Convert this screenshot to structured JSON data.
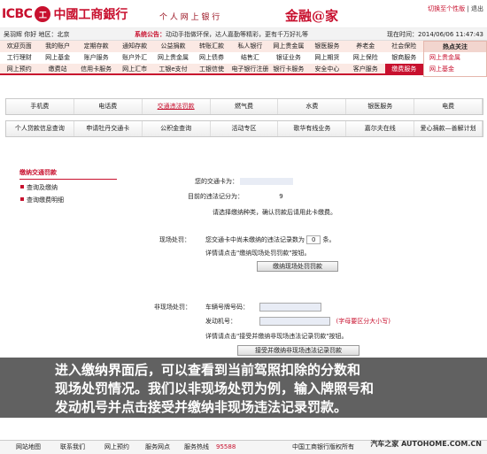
{
  "header": {
    "logo_icbc": "ICBC",
    "logo_seal": "工",
    "logo_cn": "中國工商銀行",
    "slogan": "个 人 网 上 银 行",
    "brand": "金融@家",
    "switch": "切换至个性版",
    "hint": "| 退出",
    "date": "现在时间：2014/06/06 11:47:43"
  },
  "userbar": {
    "user": "吴羽辉 你好 地区：北京",
    "notice_label": "系统公告：",
    "notice_text": "动动手指做环保，达人嘉勤等精彩，更有千万好礼等",
    "time": "2014/06/06 11:47:43"
  },
  "nav": {
    "row1": [
      "欢迎页面",
      "我的账户",
      "定期存款",
      "通知存款",
      "公益捐款",
      "转账汇款",
      "私人银行",
      "网上贵金属",
      "银医服务",
      "养老金",
      "社会保险"
    ],
    "row2": [
      "工行理财",
      "网上基金",
      "账户服务",
      "账户外汇",
      "网上贵金属",
      "网上债券",
      "结售汇",
      "银证业务",
      "网上期货",
      "网上保险",
      "银商服务"
    ],
    "row3": [
      "网上预约",
      "缴费站",
      "信用卡服务",
      "网上汇市",
      "工银e支付",
      "工银信使",
      "电子银行注册",
      "银行卡服务",
      "安全中心",
      "客户服务",
      "缴费服务"
    ],
    "active": "缴费服务"
  },
  "hot": {
    "title": "热点关注",
    "items": [
      "网上贵金属",
      "网上基金"
    ]
  },
  "tabs1": [
    "手机费",
    "电话费",
    "交通违法罚款",
    "燃气费",
    "水费",
    "银医服务",
    "电费"
  ],
  "tabs1_selected": "交通违法罚款",
  "tabs2": [
    "个人贷款信息查询",
    "申请牡丹交通卡",
    "公积金查询",
    "活动专区",
    "歌华有线业务",
    "嘉尔夫在线",
    "爱心捐款—善解计划"
  ],
  "left": {
    "title": "缴纳交通罚款",
    "items": [
      "查询及缴纳",
      "查询缴费明细"
    ]
  },
  "main": {
    "card_label": "您的交通卡为：",
    "points_label": "目前的违法记分为：",
    "points_value": "9",
    "choose": "请选择缴纳种类，确认罚款后请用此卡缴费。",
    "onsite_label": "现场处罚：",
    "onsite_text": "您交通卡中尚未缴纳的违法记录数为",
    "onsite_count": "0",
    "onsite_unit": "条。",
    "onsite_detail": "详情请点击\"缴纳现场处罚罚款\"按钮。",
    "onsite_btn": "缴纳现场处罚罚款",
    "offsite_label": "非现场处罚：",
    "plate_label": "车辆号牌号码：",
    "engine_label": "发动机号：",
    "case_hint": "(字母要区分大小写)",
    "offsite_detail": "详情请点击\"接受并缴纳非现场违法记录罚款\"按钮。",
    "offsite_btn": "接受并缴纳非现场违法记录罚款"
  },
  "subtitle": [
    "进入缴纳界面后，可以查看到当前驾照扣除的分数和",
    "现场处罚情况。我们以非现场处罚为例，输入牌照号和",
    "发动机号并点击接受并缴纳非现场违法记录罚款。"
  ],
  "footer": {
    "items": [
      "网站地图",
      "联系我们",
      "网上预约",
      "服务网点",
      "服务热线"
    ],
    "phone": "95588",
    "copyright": "中国工商银行版权所有",
    "watermark": "汽车之家 AUTOHOME.COM.CN"
  }
}
